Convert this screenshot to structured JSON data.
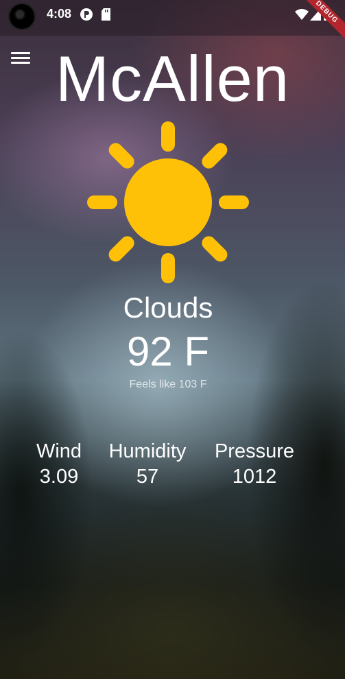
{
  "status_bar": {
    "time": "4:08",
    "icons": [
      "camera-cutout",
      "p-notification-icon",
      "sd-card-icon",
      "wifi-icon",
      "signal-icon",
      "battery-icon"
    ],
    "debug_banner": "DEBUG"
  },
  "weather": {
    "city": "McAllen",
    "icon": "sun-icon",
    "condition": "Clouds",
    "temperature": "92 F",
    "feels_like": "Feels like 103 F"
  },
  "stats": [
    {
      "label": "Wind",
      "value": "3.09"
    },
    {
      "label": "Humidity",
      "value": "57"
    },
    {
      "label": "Pressure",
      "value": "1012"
    }
  ],
  "colors": {
    "sun": "#FFC107",
    "debug_ribbon": "#B3262E",
    "text": "#FFFFFF"
  }
}
